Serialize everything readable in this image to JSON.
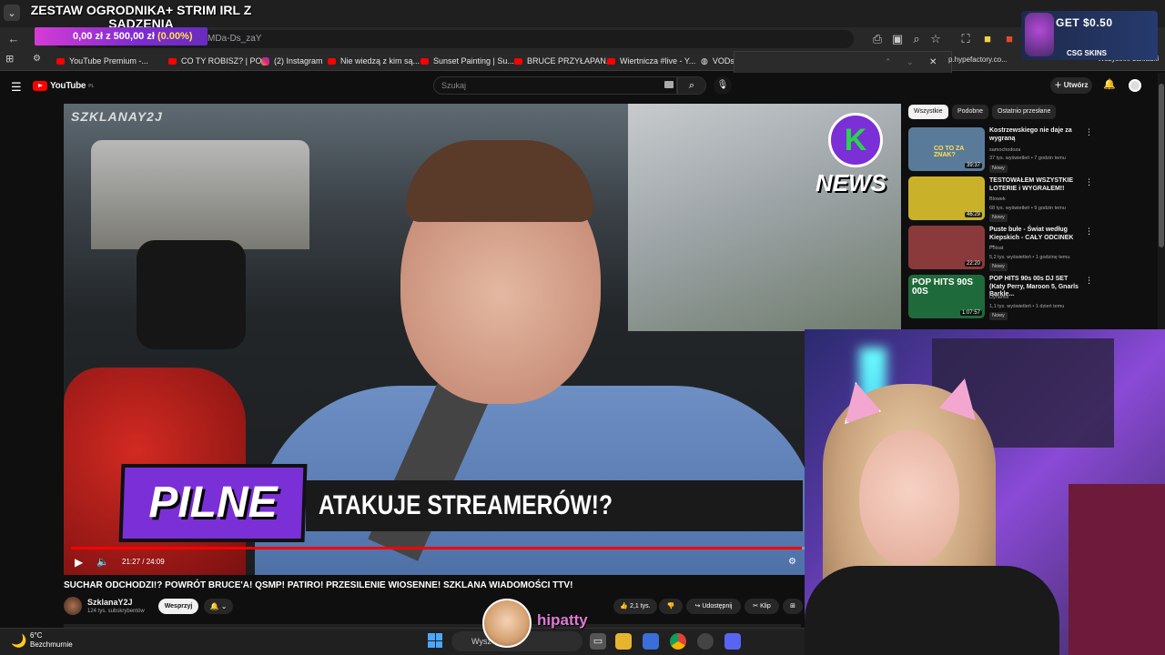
{
  "stream_overlay": {
    "title": "ZESTAW OGRODNIKA+ STRIM IRL Z SADZENIA",
    "goal_current": "0,00 zł",
    "goal_sep": "z",
    "goal_target": "500,00 zł",
    "goal_pct": "(0.00%)",
    "goal_fraction": 0,
    "streamer_name": "hipatty"
  },
  "browser": {
    "url_fragment": "MDa-Ds_zaY",
    "bookmarks": [
      {
        "label": "YouTube Premium -...",
        "icon": "youtube-icon"
      },
      {
        "label": "CO TY ROBISZ? | PO...",
        "icon": "youtube-icon"
      },
      {
        "label": "(2) Instagram",
        "icon": "instagram-icon"
      },
      {
        "label": "Nie wiedzą z kim są...",
        "icon": "youtube-icon"
      },
      {
        "label": "Sunset Painting | Su...",
        "icon": "youtube-icon"
      },
      {
        "label": "BRUCE PRZYŁAPAN...",
        "icon": "youtube-icon"
      },
      {
        "label": "Wiertnicza #live - Y...",
        "icon": "youtube-icon"
      },
      {
        "label": "VODs",
        "icon": "globe-icon"
      }
    ],
    "bookmark_extra": "p.hypefactory.co...",
    "bookmark_side": "Wszystkie zakładki"
  },
  "ad": {
    "headline": "GET $0.50",
    "brand": "CSG SKINS"
  },
  "youtube": {
    "logo_text": "YouTube",
    "logo_region": "PL",
    "search_placeholder": "Szukaj",
    "create_label": "Utwórz",
    "video": {
      "watermark": "SZKLANAY2J",
      "news_logo_text": "NEWS",
      "badge": "PILNE",
      "headline": "ATAKUJE STREAMERÓW!?",
      "time": "21:27 / 24:09",
      "progress": 0.888,
      "title": "SUCHAR ODCHODZI!? POWRÓT BRUCE'A! QSMP! PATIRO! PRZESILENIE WIOSENNE! SZKLANA WIADOMOŚCI TTV!"
    },
    "channel": {
      "name": "SzklanaY2J",
      "subs": "124 tys. subskrybentów",
      "support_label": "Wesprzyj"
    },
    "actions": {
      "likes": "2,1 tys.",
      "share": "Udostępnij",
      "clip": "Klip"
    },
    "chips": [
      "Wszystkie",
      "Podobne",
      "Ostatnio przesłane"
    ],
    "recommendations": [
      {
        "title": "Kostrzewskiego nie daje za wygraną",
        "channel": "samochodoza",
        "meta": "37 tys. wyświetleń • 7 godzin temu",
        "duration": "39:37",
        "badge": "Nowy",
        "thumb_text": "CO TO ZA ZNAK?",
        "thumb_color": "#5a7a9a"
      },
      {
        "title": "TESTOWAŁEM WSZYSTKIE LOTERIE i WYGRAŁEM!!",
        "channel": "Blowek",
        "meta": "68 tys. wyświetleń • 9 godzin temu",
        "duration": "46:29",
        "badge": "Nowy",
        "thumb_text": "",
        "thumb_color": "#c9b22a"
      },
      {
        "title": "Puste bułe - Świat według Kiepskich - CAŁY ODCINEK ...",
        "channel": "Polsat",
        "meta": "5,2 tys. wyświetleń • 1 godzinę temu",
        "duration": "22:20",
        "badge": "Nowy",
        "thumb_text": "",
        "thumb_color": "#8a3a3a"
      },
      {
        "title": "POP HITS 90s 00s DJ SET (Katy Perry, Maroon 5, Gnarls Barkle...",
        "channel": "Dynamix",
        "meta": "1,1 tys. wyświetleń • 1 dzień temu",
        "duration": "1:07:57",
        "badge": "Nowy",
        "thumb_text": "POP HITS 90S 00S",
        "thumb_color": "#1f6a3a"
      }
    ]
  },
  "taskbar": {
    "temp": "6°C",
    "weather": "Bezchmurnie",
    "search_placeholder": "Wysz"
  }
}
